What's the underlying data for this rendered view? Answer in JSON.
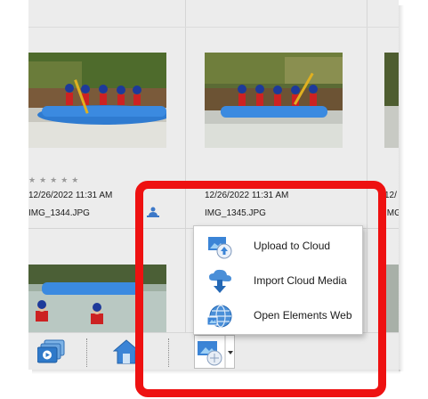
{
  "photos": [
    {
      "date": "12/26/2022 11:31 AM",
      "filename": "IMG_1344.JPG",
      "rating_stars": "★★★★★",
      "rating": 0
    },
    {
      "date": "12/26/2022 11:31 AM",
      "filename": "IMG_1345.JPG"
    },
    {
      "date": "12/",
      "filename": "IMG"
    }
  ],
  "toolbar": {
    "buttons": [
      "slideshow-icon",
      "home-icon",
      "share-dropdown-icon"
    ]
  },
  "menu": {
    "items": [
      {
        "label": "Upload to Cloud",
        "icon": "upload-cloud-icon"
      },
      {
        "label": "Import Cloud Media",
        "icon": "import-cloud-icon"
      },
      {
        "label": "Open Elements Web",
        "icon": "globe-icon"
      }
    ]
  },
  "colors": {
    "highlight": "#ee1111",
    "background": "#ececec",
    "menu_bg": "#ffffff"
  }
}
